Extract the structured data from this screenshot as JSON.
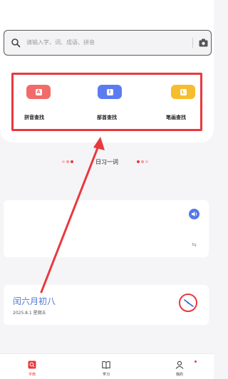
{
  "search": {
    "placeholder": "请输入字、词、成语、拼音",
    "search_icon": "search-icon",
    "camera_icon": "camera-icon"
  },
  "lookup_methods": [
    {
      "label": "拼音查找",
      "icon": "pinyin-icon",
      "glyph": "A",
      "color": "#f26b6b"
    },
    {
      "label": "部首查找",
      "icon": "radical-icon",
      "glyph": "i",
      "color": "#5b7cf0"
    },
    {
      "label": "笔画查找",
      "icon": "stroke-icon",
      "glyph": "L",
      "color": "#f6bd2f"
    }
  ],
  "daily_word": {
    "title": "日习一词",
    "speaker_icon": "speaker-icon",
    "swap_icon": "swap-icon"
  },
  "calendar": {
    "lunar": "闰六月初八",
    "solar": "2025.8.1 星期五",
    "clock_icon": "clock-icon"
  },
  "bottom_nav": [
    {
      "label": "字典",
      "icon": "dictionary-icon",
      "active": true
    },
    {
      "label": "学习",
      "icon": "book-icon",
      "active": false
    },
    {
      "label": "我的",
      "icon": "user-icon",
      "active": false
    }
  ],
  "colors": {
    "accent_red": "#e8393e",
    "accent_blue": "#5577e9",
    "lunar_text": "#4a73d4"
  }
}
